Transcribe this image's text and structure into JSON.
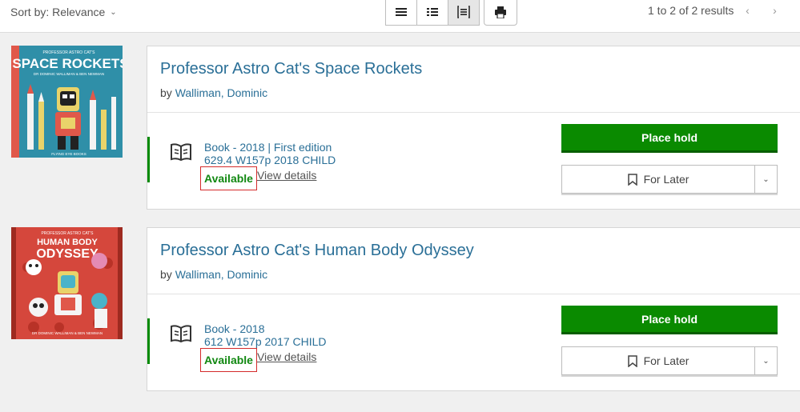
{
  "toolbar": {
    "sort_label": "Sort by: Relevance",
    "results_text": "1 to 2 of 2 results",
    "view_modes": [
      "list-view",
      "compact-view",
      "detailed-view"
    ],
    "active_view": "detailed-view"
  },
  "results": [
    {
      "title": "Professor Astro Cat's Space Rockets",
      "by": "by",
      "author": "Walliman, Dominic",
      "format_line": "Book - 2018 | First edition",
      "call_number": "629.4 W157p 2018 CHILD",
      "status": "Available",
      "details_link": "View details",
      "hold_label": "Place hold",
      "later_label": "For Later",
      "cover": {
        "top_small": "PROFESSOR ASTRO CAT'S",
        "title": "SPACE ROCKETS",
        "authors": "DR DOMINIC WALLIMAN & BEN NEWMAN",
        "publisher": "FLYING EYE BOOKS",
        "bg_color": "#2f8fa8",
        "accent_color": "#e9d36a"
      }
    },
    {
      "title": "Professor Astro Cat's Human Body Odyssey",
      "by": "by",
      "author": "Walliman, Dominic",
      "format_line": "Book - 2018",
      "call_number": "612 W157p 2017 CHILD",
      "status": "Available",
      "details_link": "View details",
      "hold_label": "Place hold",
      "later_label": "For Later",
      "cover": {
        "top_small": "PROFESSOR ASTRO CAT'S",
        "title_line1": "HUMAN BODY",
        "title_line2": "ODYSSEY",
        "authors": "DR DOMINIC WALLIMAN & BEN NEWMAN",
        "bg_color": "#d5473c",
        "accent_color": "#f2c0b4"
      }
    }
  ]
}
